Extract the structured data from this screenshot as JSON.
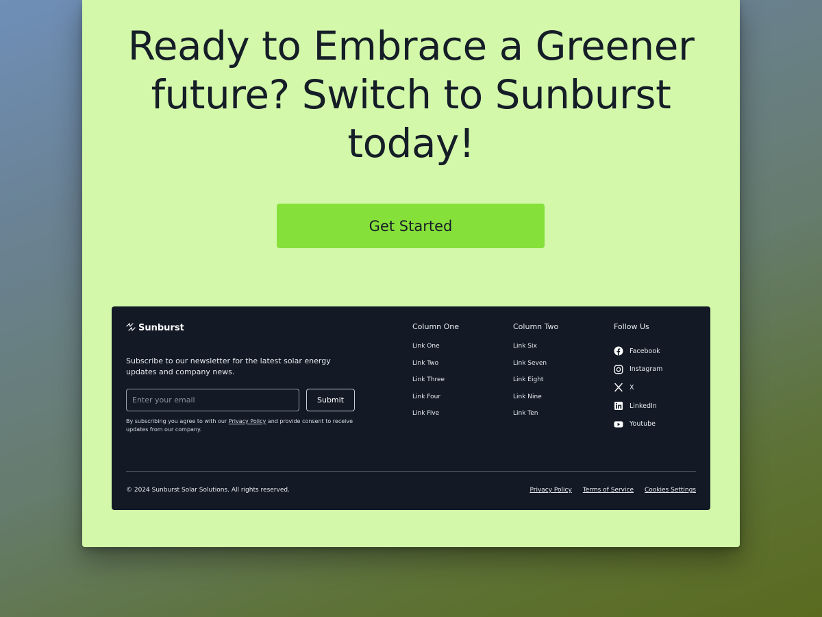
{
  "hero": {
    "headline": "Ready to Embrace a Greener future? Switch to Sunburst today!",
    "cta_label": "Get Started"
  },
  "footer": {
    "brand": "Sunburst",
    "newsletter_text": "Subscribe to our newsletter for the latest solar energy updates and company news.",
    "email_placeholder": "Enter your email",
    "submit_label": "Submit",
    "consent_prefix": "By subscribing you agree to with our ",
    "consent_link": "Privacy Policy",
    "consent_suffix": " and provide consent to receive updates from our company.",
    "columns": [
      {
        "title": "Column One",
        "links": [
          "Link One",
          "Link Two",
          "Link Three",
          "Link Four",
          "Link Five"
        ]
      },
      {
        "title": "Column Two",
        "links": [
          "Link Six",
          "Link Seven",
          "Link Eight",
          "Link Nine",
          "Link Ten"
        ]
      }
    ],
    "follow": {
      "title": "Follow Us",
      "items": [
        {
          "label": "Facebook",
          "icon": "facebook-icon"
        },
        {
          "label": "Instagram",
          "icon": "instagram-icon"
        },
        {
          "label": "X",
          "icon": "x-icon"
        },
        {
          "label": "LinkedIn",
          "icon": "linkedin-icon"
        },
        {
          "label": "Youtube",
          "icon": "youtube-icon"
        }
      ]
    },
    "copyright": "© 2024 Sunburst Solar Solutions. All rights reserved.",
    "legal_links": [
      "Privacy Policy",
      "Terms of Service",
      "Cookies Settings"
    ]
  },
  "colors": {
    "card_bg": "#d3f8aa",
    "cta_bg": "#86e03a",
    "footer_bg": "#131a26",
    "text_dark": "#151d27"
  }
}
